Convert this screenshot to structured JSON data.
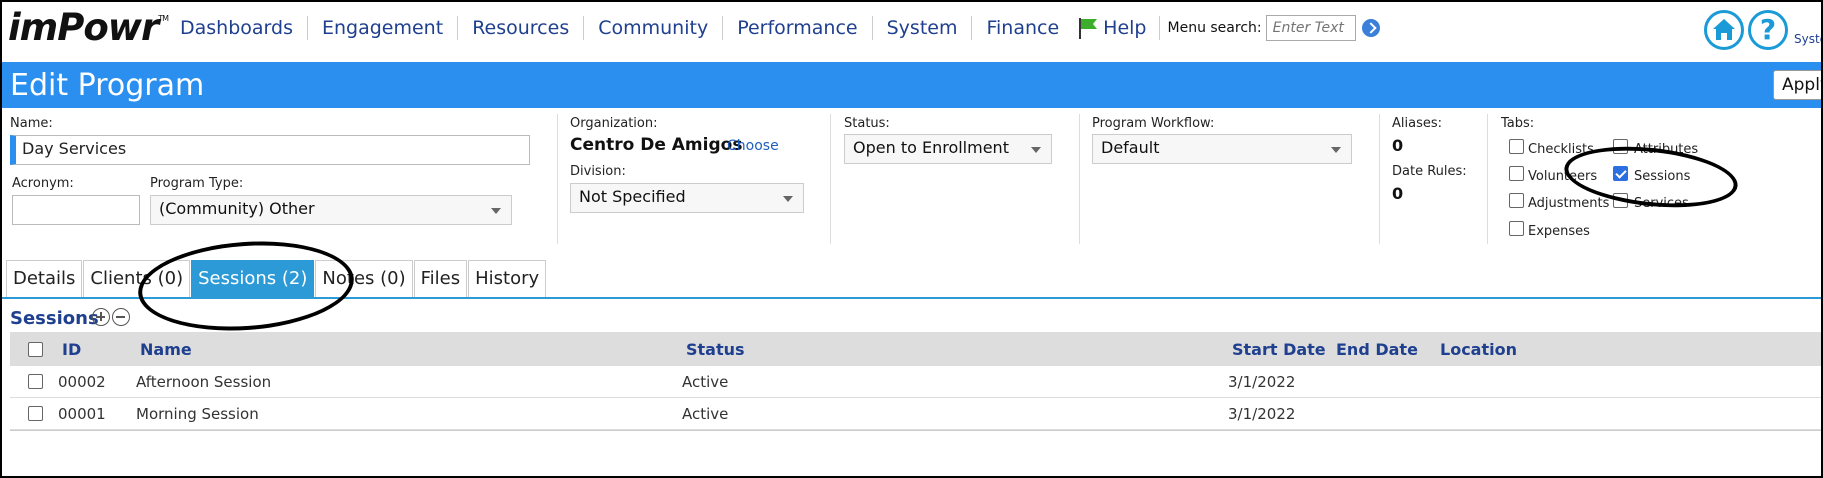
{
  "nav": {
    "logo": "imPowr",
    "logo_tm": "TM",
    "items": [
      "Dashboards",
      "Engagement",
      "Resources",
      "Community",
      "Performance",
      "System",
      "Finance"
    ],
    "help": "Help",
    "menu_search_label": "Menu search:",
    "menu_search_placeholder": "Enter Text",
    "system_link": "Syste"
  },
  "page": {
    "title": "Edit Program",
    "apply_label": "Apply"
  },
  "form": {
    "name_label": "Name:",
    "name_value": "Day Services",
    "acronym_label": "Acronym:",
    "acronym_value": "",
    "program_type_label": "Program Type:",
    "program_type_value": "(Community) Other",
    "organization_label": "Organization:",
    "organization_value": "Centro De Amigos",
    "choose_label": "Choose",
    "division_label": "Division:",
    "division_value": "Not Specified",
    "status_label": "Status:",
    "status_value": "Open to Enrollment",
    "workflow_label": "Program Workflow:",
    "workflow_value": "Default",
    "aliases_label": "Aliases:",
    "aliases_value": "0",
    "date_rules_label": "Date Rules:",
    "date_rules_value": "0",
    "tabs_label": "Tabs:",
    "tab_options": {
      "checklists": {
        "label": "Checklists",
        "checked": false
      },
      "attributes": {
        "label": "Attributes",
        "checked": false
      },
      "volunteers": {
        "label": "Volunteers",
        "checked": false
      },
      "sessions": {
        "label": "Sessions",
        "checked": true
      },
      "adjustments": {
        "label": "Adjustments",
        "checked": false
      },
      "services": {
        "label": "Services",
        "checked": false
      },
      "expenses": {
        "label": "Expenses",
        "checked": false
      }
    }
  },
  "tabs": [
    "Details",
    "Clients (0)",
    "Sessions (2)",
    "Notes (0)",
    "Files",
    "History"
  ],
  "active_tab": "Sessions (2)",
  "sessions": {
    "title": "Sessions",
    "columns": [
      "ID",
      "Name",
      "Status",
      "Start Date",
      "End Date",
      "Location"
    ],
    "rows": [
      {
        "id": "00002",
        "name": "Afternoon Session",
        "status": "Active",
        "start_date": "3/1/2022",
        "end_date": "",
        "location": ""
      },
      {
        "id": "00001",
        "name": "Morning Session",
        "status": "Active",
        "start_date": "3/1/2022",
        "end_date": "",
        "location": ""
      }
    ]
  },
  "colors": {
    "accent": "#2b8ff0",
    "tab_active": "#2b9ad6",
    "link": "#1f3f8f"
  }
}
